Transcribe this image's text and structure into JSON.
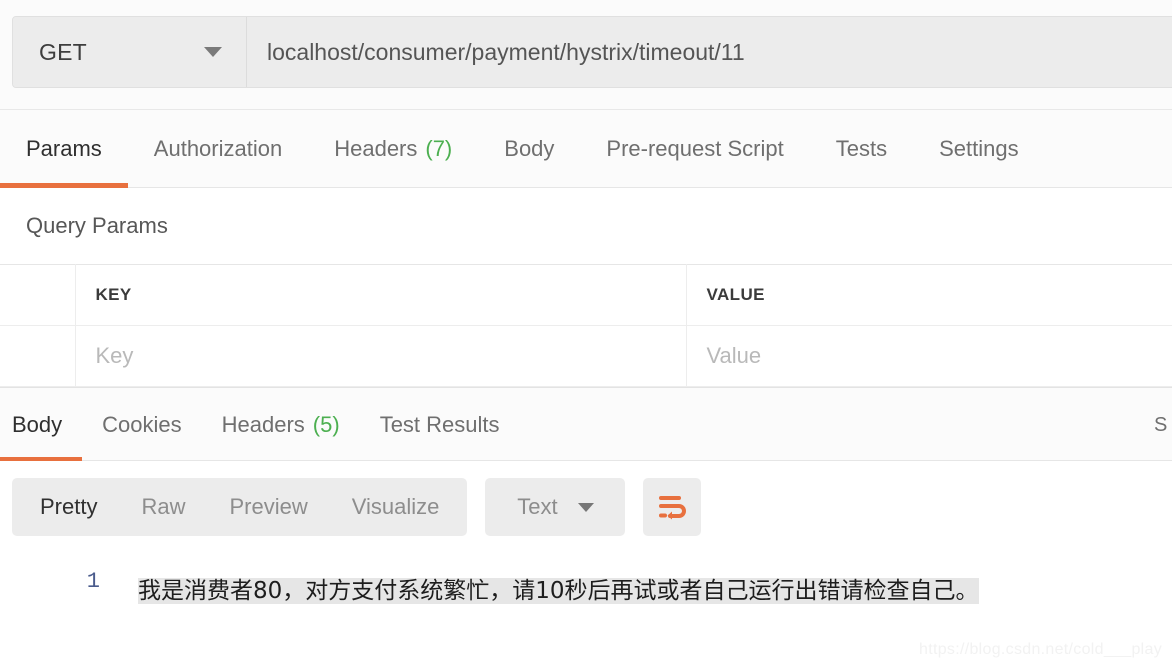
{
  "request": {
    "method": "GET",
    "url": "localhost/consumer/payment/hystrix/timeout/11",
    "method_caret": "chevron-down-icon"
  },
  "request_tabs": [
    {
      "label": "Params",
      "count": "",
      "active": true
    },
    {
      "label": "Authorization",
      "count": "",
      "active": false
    },
    {
      "label": "Headers",
      "count": "(7)",
      "active": false
    },
    {
      "label": "Body",
      "count": "",
      "active": false
    },
    {
      "label": "Pre-request Script",
      "count": "",
      "active": false
    },
    {
      "label": "Tests",
      "count": "",
      "active": false
    },
    {
      "label": "Settings",
      "count": "",
      "active": false
    }
  ],
  "query_params": {
    "section_title": "Query Params",
    "headers": {
      "check": "",
      "key": "KEY",
      "value": "VALUE"
    },
    "rows": [
      {
        "check": "",
        "key_placeholder": "Key",
        "value_placeholder": "Value"
      }
    ]
  },
  "response_tabs": [
    {
      "label": "Body",
      "count": "",
      "active": true
    },
    {
      "label": "Cookies",
      "count": "",
      "active": false
    },
    {
      "label": "Headers",
      "count": "(5)",
      "active": false
    },
    {
      "label": "Test Results",
      "count": "",
      "active": false
    }
  ],
  "response_meta": {
    "status_truncated": "S"
  },
  "body_toolbar": {
    "views": [
      {
        "label": "Pretty",
        "active": true
      },
      {
        "label": "Raw",
        "active": false
      },
      {
        "label": "Preview",
        "active": false
      },
      {
        "label": "Visualize",
        "active": false
      }
    ],
    "format": "Text",
    "format_caret": "chevron-down-icon",
    "wrap_icon": "word-wrap-icon"
  },
  "response_body": {
    "line_number": "1",
    "text": "我是消费者80，对方支付系统繁忙，请10秒后再试或者自己运行出错请检查自己。"
  },
  "watermark": "https://blog.csdn.net/cold___play",
  "colors": {
    "accent": "#e8703e",
    "count_green": "#4caf50",
    "toolbar_bg": "#ececec",
    "line_number": "#4a5b8c"
  }
}
